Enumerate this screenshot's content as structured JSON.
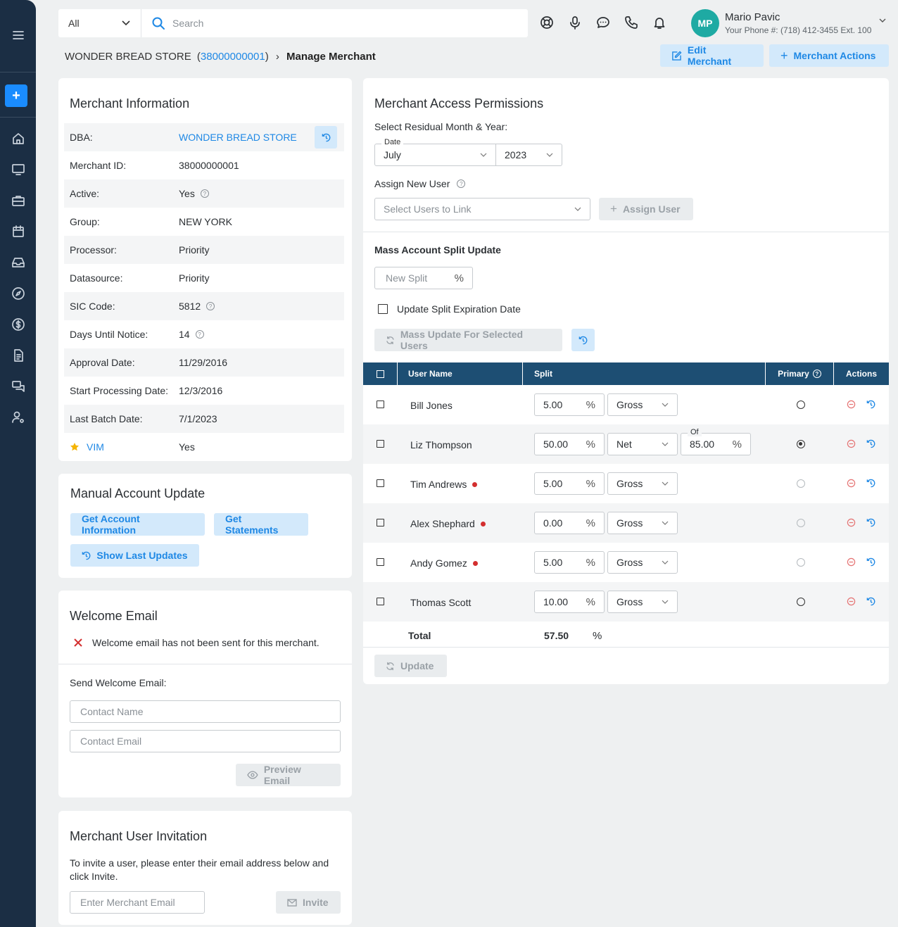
{
  "search": {
    "scope": "All",
    "placeholder": "Search"
  },
  "user": {
    "initials": "MP",
    "name": "Mario Pavic",
    "phone": "Your Phone #: (718) 412-3455 Ext. 100"
  },
  "breadcrumb": {
    "store": "WONDER BREAD STORE",
    "id": "(38000000001)",
    "open": "(",
    "id_num": "38000000001",
    "close": ")",
    "sep": "›",
    "current": "Manage Merchant"
  },
  "header_actions": {
    "edit": "Edit Merchant",
    "actions": "Merchant Actions"
  },
  "merchant_info": {
    "title": "Merchant Information",
    "rows": [
      {
        "label": "DBA:",
        "value": "WONDER BREAD STORE"
      },
      {
        "label": "Merchant ID:",
        "value": "38000000001"
      },
      {
        "label": "Active:",
        "value": "Yes"
      },
      {
        "label": "Group:",
        "value": "NEW YORK"
      },
      {
        "label": "Processor:",
        "value": "Priority"
      },
      {
        "label": "Datasource:",
        "value": "Priority"
      },
      {
        "label": "SIC Code:",
        "value": "5812"
      },
      {
        "label": "Days Until Notice:",
        "value": "14"
      },
      {
        "label": "Approval Date:",
        "value": "11/29/2016"
      },
      {
        "label": "Start Processing Date:",
        "value": "12/3/2016"
      },
      {
        "label": "Last Batch Date:",
        "value": "7/1/2023"
      },
      {
        "label": "VIM",
        "value": "Yes"
      }
    ]
  },
  "manual_update": {
    "title": "Manual Account Update",
    "get_info": "Get Account Information",
    "get_statements": "Get Statements",
    "show_last": "Show Last Updates"
  },
  "welcome": {
    "title": "Welcome Email",
    "status": "Welcome email has not been sent for this merchant.",
    "send_label": "Send Welcome Email:",
    "contact_name_ph": "Contact Name",
    "contact_email_ph": "Contact Email",
    "preview": "Preview Email"
  },
  "invitation": {
    "title": "Merchant User Invitation",
    "text": "To invite a user, please enter their email address below and click Invite.",
    "email_ph": "Enter Merchant Email",
    "invite": "Invite"
  },
  "permissions": {
    "title": "Merchant Access Permissions",
    "residual_label": "Select Residual Month & Year:",
    "date_label": "Date",
    "month": "July",
    "year": "2023",
    "assign_label": "Assign New User",
    "assign_ph": "Select Users to Link",
    "assign_btn": "Assign User",
    "mass_title": "Mass Account Split Update",
    "new_split_ph": "New Split",
    "pct": "%",
    "expiration_label": "Update Split Expiration Date",
    "mass_btn": "Mass Update For Selected Users",
    "columns": {
      "user": "User Name",
      "split": "Split",
      "primary": "Primary",
      "actions": "Actions"
    },
    "of_label": "Of",
    "rows": [
      {
        "name": "Bill Jones",
        "split": "5.00",
        "type": "Gross",
        "of": "",
        "primary": "selectable"
      },
      {
        "name": "Liz Thompson",
        "split": "50.00",
        "type": "Net",
        "of": "85.00",
        "primary": "selected"
      },
      {
        "name": "Tim Andrews",
        "split": "5.00",
        "type": "Gross",
        "of": "",
        "primary": "disabled"
      },
      {
        "name": "Alex Shephard",
        "split": "0.00",
        "type": "Gross",
        "of": "",
        "primary": "disabled"
      },
      {
        "name": "Andy Gomez",
        "split": "5.00",
        "type": "Gross",
        "of": "",
        "primary": "disabled"
      },
      {
        "name": "Thomas Scott",
        "split": "10.00",
        "type": "Gross",
        "of": "",
        "primary": "selectable"
      }
    ],
    "total_label": "Total",
    "total_value": "57.50",
    "update_btn": "Update"
  },
  "colors": {
    "accent": "#1e88e5",
    "sidebar": "#1b2e44",
    "table_header": "#1d4e73",
    "danger": "#d32f2f"
  }
}
